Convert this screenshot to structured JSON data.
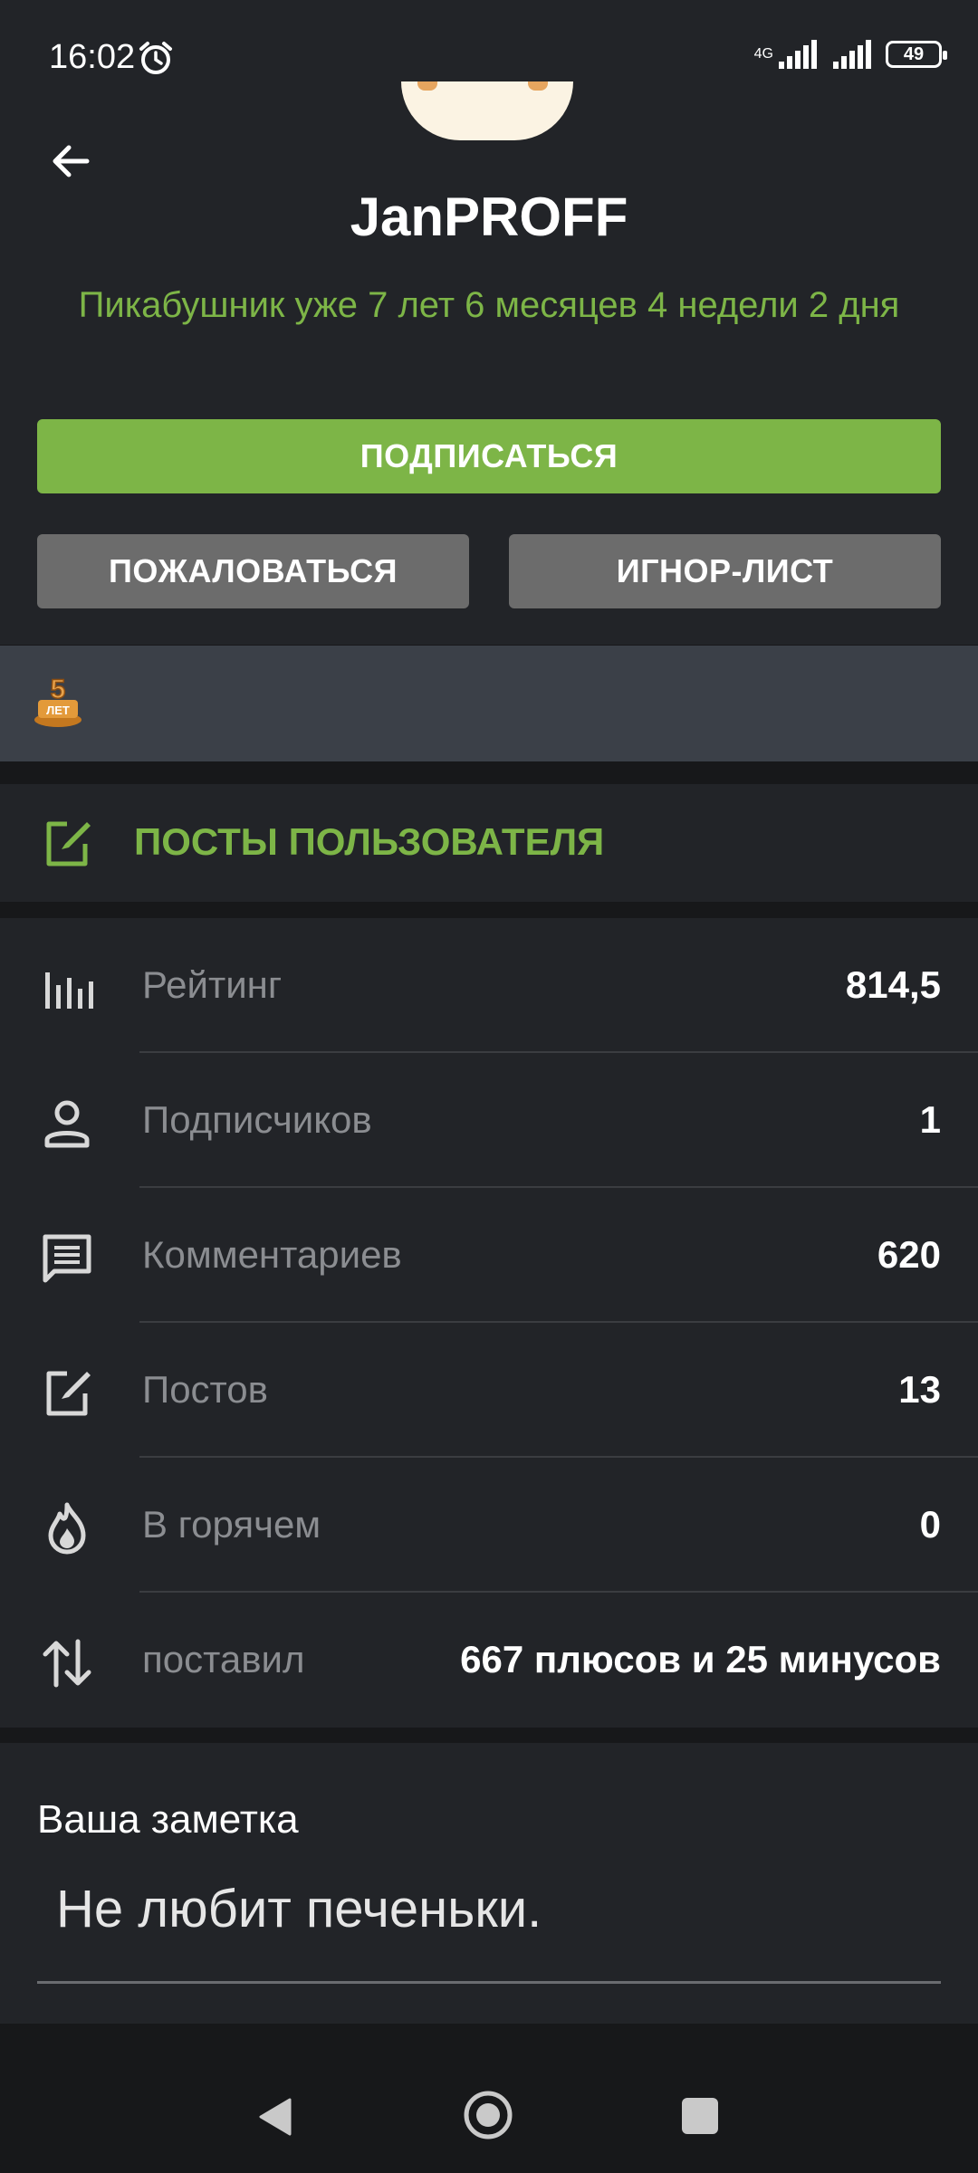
{
  "status_bar": {
    "time": "16:02",
    "network": "4G",
    "battery": "49"
  },
  "profile": {
    "username": "JanPROFF",
    "tenure": "Пикабушник уже 7 лет 6 месяцев 4 недели 2 дня"
  },
  "buttons": {
    "subscribe": "ПОДПИСАТЬСЯ",
    "report": "ПОЖАЛОВАТЬСЯ",
    "ignore": "ИГНОР-ЛИСТ"
  },
  "awards": [
    {
      "icon": "five-years-award-icon",
      "text": "5 ЛЕТ"
    }
  ],
  "posts_link": {
    "label": "ПОСТЫ ПОЛЬЗОВАТЕЛЯ"
  },
  "stats": [
    {
      "icon": "bar-chart-icon",
      "label": "Рейтинг",
      "value": "814,5"
    },
    {
      "icon": "person-icon",
      "label": "Подписчиков",
      "value": "1"
    },
    {
      "icon": "comment-icon",
      "label": "Комментариев",
      "value": "620"
    },
    {
      "icon": "edit-icon",
      "label": "Постов",
      "value": "13"
    },
    {
      "icon": "fire-icon",
      "label": "В горячем",
      "value": "0"
    },
    {
      "icon": "sort-arrows-icon",
      "label": "поставил",
      "value": "667 плюсов и 25 минусов"
    }
  ],
  "note": {
    "title": "Ваша заметка",
    "text": "Не любит печеньки."
  },
  "colors": {
    "accent": "#7db547",
    "background": "#222428",
    "secondary_button": "#6c6c6c",
    "award_bar": "#3b4048"
  }
}
